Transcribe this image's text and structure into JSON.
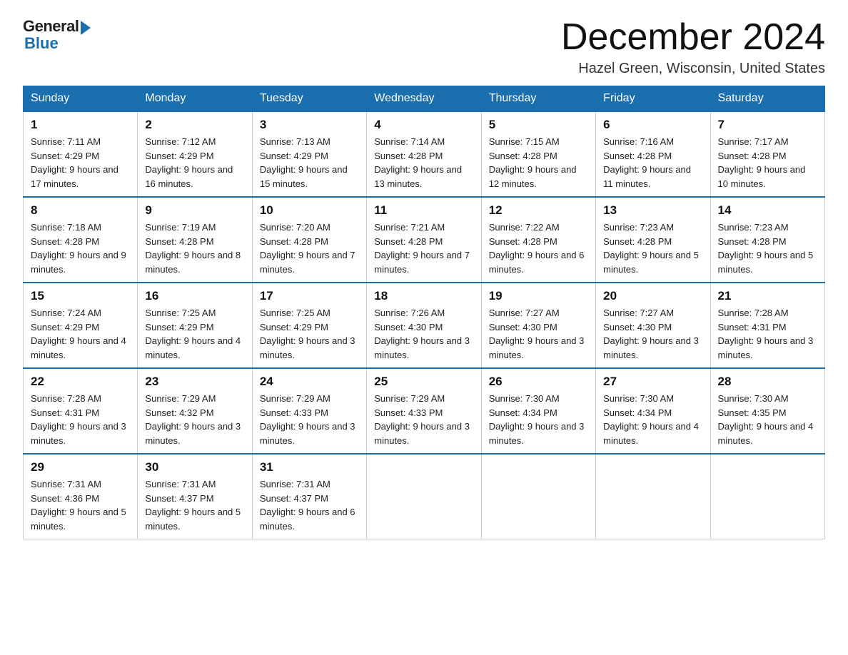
{
  "logo": {
    "general": "General",
    "blue": "Blue"
  },
  "title": {
    "month": "December 2024",
    "location": "Hazel Green, Wisconsin, United States"
  },
  "days_of_week": [
    "Sunday",
    "Monday",
    "Tuesday",
    "Wednesday",
    "Thursday",
    "Friday",
    "Saturday"
  ],
  "weeks": [
    [
      {
        "day": "1",
        "sunrise": "7:11 AM",
        "sunset": "4:29 PM",
        "daylight": "9 hours and 17 minutes."
      },
      {
        "day": "2",
        "sunrise": "7:12 AM",
        "sunset": "4:29 PM",
        "daylight": "9 hours and 16 minutes."
      },
      {
        "day": "3",
        "sunrise": "7:13 AM",
        "sunset": "4:29 PM",
        "daylight": "9 hours and 15 minutes."
      },
      {
        "day": "4",
        "sunrise": "7:14 AM",
        "sunset": "4:28 PM",
        "daylight": "9 hours and 13 minutes."
      },
      {
        "day": "5",
        "sunrise": "7:15 AM",
        "sunset": "4:28 PM",
        "daylight": "9 hours and 12 minutes."
      },
      {
        "day": "6",
        "sunrise": "7:16 AM",
        "sunset": "4:28 PM",
        "daylight": "9 hours and 11 minutes."
      },
      {
        "day": "7",
        "sunrise": "7:17 AM",
        "sunset": "4:28 PM",
        "daylight": "9 hours and 10 minutes."
      }
    ],
    [
      {
        "day": "8",
        "sunrise": "7:18 AM",
        "sunset": "4:28 PM",
        "daylight": "9 hours and 9 minutes."
      },
      {
        "day": "9",
        "sunrise": "7:19 AM",
        "sunset": "4:28 PM",
        "daylight": "9 hours and 8 minutes."
      },
      {
        "day": "10",
        "sunrise": "7:20 AM",
        "sunset": "4:28 PM",
        "daylight": "9 hours and 7 minutes."
      },
      {
        "day": "11",
        "sunrise": "7:21 AM",
        "sunset": "4:28 PM",
        "daylight": "9 hours and 7 minutes."
      },
      {
        "day": "12",
        "sunrise": "7:22 AM",
        "sunset": "4:28 PM",
        "daylight": "9 hours and 6 minutes."
      },
      {
        "day": "13",
        "sunrise": "7:23 AM",
        "sunset": "4:28 PM",
        "daylight": "9 hours and 5 minutes."
      },
      {
        "day": "14",
        "sunrise": "7:23 AM",
        "sunset": "4:28 PM",
        "daylight": "9 hours and 5 minutes."
      }
    ],
    [
      {
        "day": "15",
        "sunrise": "7:24 AM",
        "sunset": "4:29 PM",
        "daylight": "9 hours and 4 minutes."
      },
      {
        "day": "16",
        "sunrise": "7:25 AM",
        "sunset": "4:29 PM",
        "daylight": "9 hours and 4 minutes."
      },
      {
        "day": "17",
        "sunrise": "7:25 AM",
        "sunset": "4:29 PM",
        "daylight": "9 hours and 3 minutes."
      },
      {
        "day": "18",
        "sunrise": "7:26 AM",
        "sunset": "4:30 PM",
        "daylight": "9 hours and 3 minutes."
      },
      {
        "day": "19",
        "sunrise": "7:27 AM",
        "sunset": "4:30 PM",
        "daylight": "9 hours and 3 minutes."
      },
      {
        "day": "20",
        "sunrise": "7:27 AM",
        "sunset": "4:30 PM",
        "daylight": "9 hours and 3 minutes."
      },
      {
        "day": "21",
        "sunrise": "7:28 AM",
        "sunset": "4:31 PM",
        "daylight": "9 hours and 3 minutes."
      }
    ],
    [
      {
        "day": "22",
        "sunrise": "7:28 AM",
        "sunset": "4:31 PM",
        "daylight": "9 hours and 3 minutes."
      },
      {
        "day": "23",
        "sunrise": "7:29 AM",
        "sunset": "4:32 PM",
        "daylight": "9 hours and 3 minutes."
      },
      {
        "day": "24",
        "sunrise": "7:29 AM",
        "sunset": "4:33 PM",
        "daylight": "9 hours and 3 minutes."
      },
      {
        "day": "25",
        "sunrise": "7:29 AM",
        "sunset": "4:33 PM",
        "daylight": "9 hours and 3 minutes."
      },
      {
        "day": "26",
        "sunrise": "7:30 AM",
        "sunset": "4:34 PM",
        "daylight": "9 hours and 3 minutes."
      },
      {
        "day": "27",
        "sunrise": "7:30 AM",
        "sunset": "4:34 PM",
        "daylight": "9 hours and 4 minutes."
      },
      {
        "day": "28",
        "sunrise": "7:30 AM",
        "sunset": "4:35 PM",
        "daylight": "9 hours and 4 minutes."
      }
    ],
    [
      {
        "day": "29",
        "sunrise": "7:31 AM",
        "sunset": "4:36 PM",
        "daylight": "9 hours and 5 minutes."
      },
      {
        "day": "30",
        "sunrise": "7:31 AM",
        "sunset": "4:37 PM",
        "daylight": "9 hours and 5 minutes."
      },
      {
        "day": "31",
        "sunrise": "7:31 AM",
        "sunset": "4:37 PM",
        "daylight": "9 hours and 6 minutes."
      },
      null,
      null,
      null,
      null
    ]
  ]
}
